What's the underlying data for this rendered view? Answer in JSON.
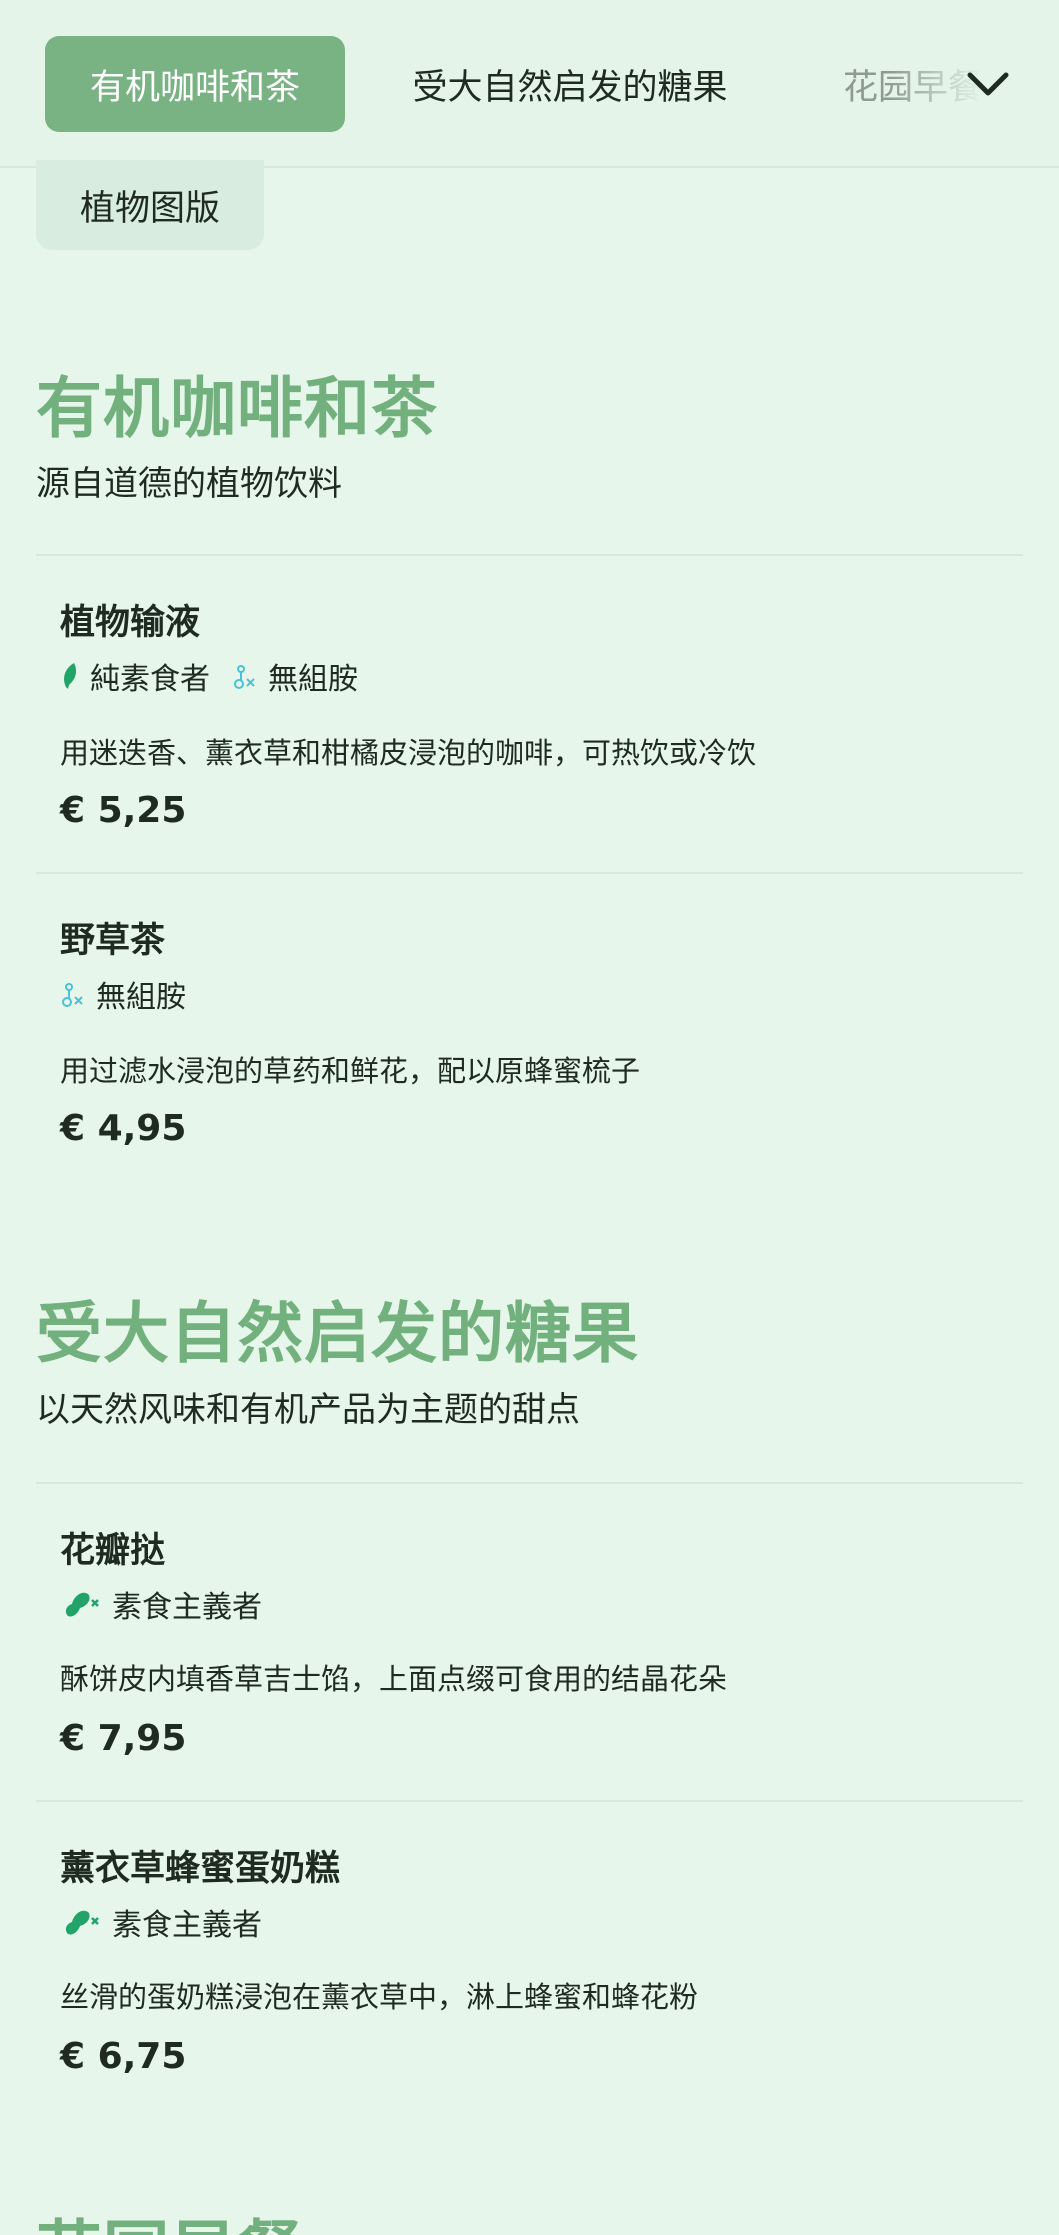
{
  "nav": {
    "tabs": [
      {
        "label": "有机咖啡和茶",
        "active": true
      },
      {
        "label": "受大自然启发的糖果",
        "active": false
      },
      {
        "label": "花园早餐",
        "active": false
      }
    ],
    "sub_tab": "植物图版"
  },
  "sections": [
    {
      "title": "有机咖啡和茶",
      "subtitle": "源自道德的植物饮料",
      "items": [
        {
          "name": "植物输液",
          "tags": [
            {
              "label": "純素食者",
              "icon": "leaf-icon"
            },
            {
              "label": "無組胺",
              "icon": "histamine-free-icon"
            }
          ],
          "description": "用迷迭香、薰衣草和柑橘皮浸泡的咖啡，可热饮或冷饮",
          "price": "€ 5,25"
        },
        {
          "name": "野草茶",
          "tags": [
            {
              "label": "無組胺",
              "icon": "histamine-free-icon"
            }
          ],
          "description": "用过滤水浸泡的草药和鲜花，配以原蜂蜜梳子",
          "price": "€ 4,95"
        }
      ]
    },
    {
      "title": "受大自然启发的糖果",
      "subtitle": "以天然风味和有机产品为主题的甜点",
      "items": [
        {
          "name": "花瓣挞",
          "tags": [
            {
              "label": "素食主義者",
              "icon": "no-meat-icon"
            }
          ],
          "description": "酥饼皮内填香草吉士馅，上面点缀可食用的结晶花朵",
          "price": "€ 7,95"
        },
        {
          "name": "薰衣草蜂蜜蛋奶糕",
          "tags": [
            {
              "label": "素食主義者",
              "icon": "no-meat-icon"
            }
          ],
          "description": "丝滑的蛋奶糕浸泡在薰衣草中，淋上蜂蜜和蜂花粉",
          "price": "€ 6,75"
        }
      ]
    },
    {
      "title": "花园早餐"
    }
  ],
  "colors": {
    "background": "#e6f6ea",
    "accent": "#72b07e",
    "active_tab": "#79b384",
    "leaf_icon": "#22a36a",
    "histamine_icon": "#48c2d8"
  }
}
